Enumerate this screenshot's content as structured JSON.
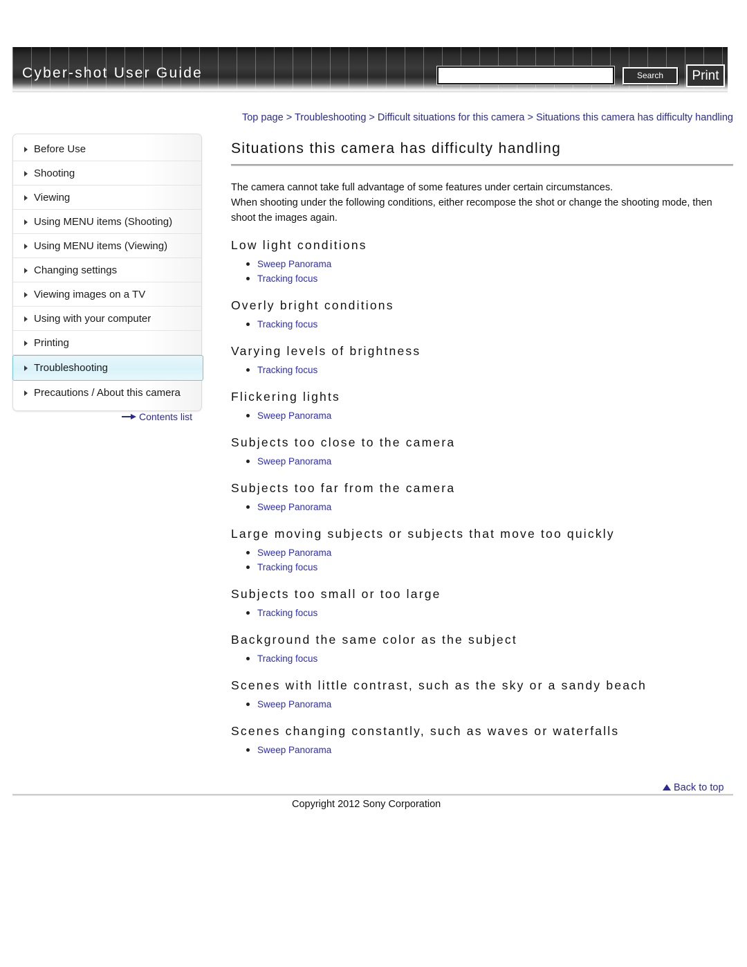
{
  "header": {
    "guide_title": "Cyber-shot User Guide",
    "search_value": "",
    "search_placeholder": "",
    "search_button_label": "Search",
    "print_button_label": "Print"
  },
  "breadcrumb": {
    "items": [
      "Top page",
      "Troubleshooting",
      "Difficult situations for this camera",
      "Situations this camera has difficulty handling"
    ],
    "separator": ">"
  },
  "sidebar": {
    "items": [
      {
        "label": "Before Use",
        "active": false
      },
      {
        "label": "Shooting",
        "active": false
      },
      {
        "label": "Viewing",
        "active": false
      },
      {
        "label": "Using MENU items (Shooting)",
        "active": false
      },
      {
        "label": "Using MENU items (Viewing)",
        "active": false
      },
      {
        "label": "Changing settings",
        "active": false
      },
      {
        "label": "Viewing images on a TV",
        "active": false
      },
      {
        "label": "Using with your computer",
        "active": false
      },
      {
        "label": "Printing",
        "active": false
      },
      {
        "label": "Troubleshooting",
        "active": true
      },
      {
        "label": "Precautions / About this camera",
        "active": false
      }
    ],
    "contents_list_label": "Contents list"
  },
  "main": {
    "page_title": "Situations this camera has difficulty handling",
    "intro_line1": "The camera cannot take full advantage of some features under certain circumstances.",
    "intro_line2": "When shooting under the following conditions, either recompose the shot or change the shooting mode, then shoot the images again.",
    "sections": [
      {
        "heading": "Low light conditions",
        "links": [
          "Sweep Panorama",
          "Tracking focus"
        ]
      },
      {
        "heading": "Overly bright conditions",
        "links": [
          "Tracking focus"
        ]
      },
      {
        "heading": "Varying levels of brightness",
        "links": [
          "Tracking focus"
        ]
      },
      {
        "heading": "Flickering lights",
        "links": [
          "Sweep Panorama"
        ]
      },
      {
        "heading": "Subjects too close to the camera",
        "links": [
          "Sweep Panorama"
        ]
      },
      {
        "heading": "Subjects too far from the camera",
        "links": [
          "Sweep Panorama"
        ]
      },
      {
        "heading": "Large moving subjects or subjects that move too quickly",
        "links": [
          "Sweep Panorama",
          "Tracking focus"
        ]
      },
      {
        "heading": "Subjects too small or too large",
        "links": [
          "Tracking focus"
        ]
      },
      {
        "heading": "Background the same color as the subject",
        "links": [
          "Tracking focus"
        ]
      },
      {
        "heading": "Scenes with little contrast, such as the sky or a sandy beach",
        "links": [
          "Sweep Panorama"
        ]
      },
      {
        "heading": "Scenes changing constantly, such as waves or waterfalls",
        "links": [
          "Sweep Panorama"
        ]
      }
    ]
  },
  "footer": {
    "back_to_top_label": "Back to top",
    "copyright": "Copyright 2012 Sony Corporation"
  },
  "colors": {
    "link": "#2b2bcc",
    "breadcrumb_link": "#2a2a9c",
    "active_item_bg": "#d9f2f9",
    "active_item_border": "#6fc6e0",
    "banner_dark": "#2b2b2b"
  }
}
